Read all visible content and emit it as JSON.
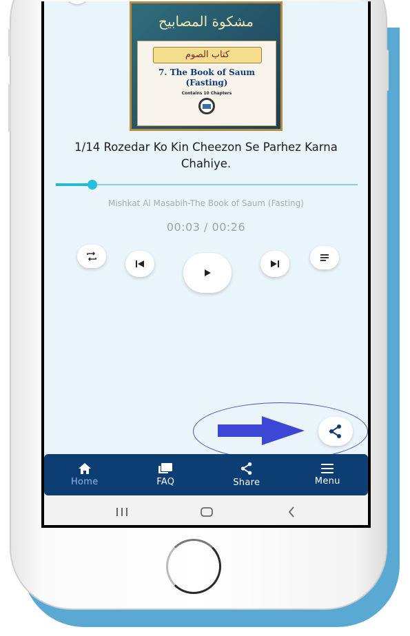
{
  "cover": {
    "arabic_title": "مشكوة المصابيح",
    "arabic_banner": "كتاب الصوم",
    "english_title_1": "7. The Book of Saum",
    "english_title_2": "(Fasting)",
    "subtitle": "Contains 10 Chapters"
  },
  "player": {
    "track_title": "1/14 Rozedar Ko Kin Cheezon Se Parhez Karna Chahiye.",
    "album": "Mishkat Al Masabih-The Book of Saum (Fasting)",
    "time_display": "00:03 / 00:26",
    "progress_fraction": 0.12,
    "controls": [
      "repeat-icon",
      "previous-icon",
      "play-icon",
      "next-icon",
      "playlist-icon"
    ],
    "share_fab_icon": "share-icon"
  },
  "annotation": {
    "arrow_color": "#3d47d6",
    "ring_color": "#4a4fc0"
  },
  "bottom_nav": {
    "items": [
      {
        "label": "Home",
        "icon": "home-icon",
        "active": true
      },
      {
        "label": "FAQ",
        "icon": "chat-icon",
        "active": false
      },
      {
        "label": "Share",
        "icon": "share-icon",
        "active": false
      },
      {
        "label": "Menu",
        "icon": "menu-icon",
        "active": false
      }
    ]
  },
  "system_nav": {
    "icons": [
      "recents-icon",
      "home-outline-icon",
      "back-icon"
    ]
  },
  "colors": {
    "background": "#eaf4fb",
    "accent": "#22c0dc",
    "nav_bg": "#0c3d73"
  }
}
